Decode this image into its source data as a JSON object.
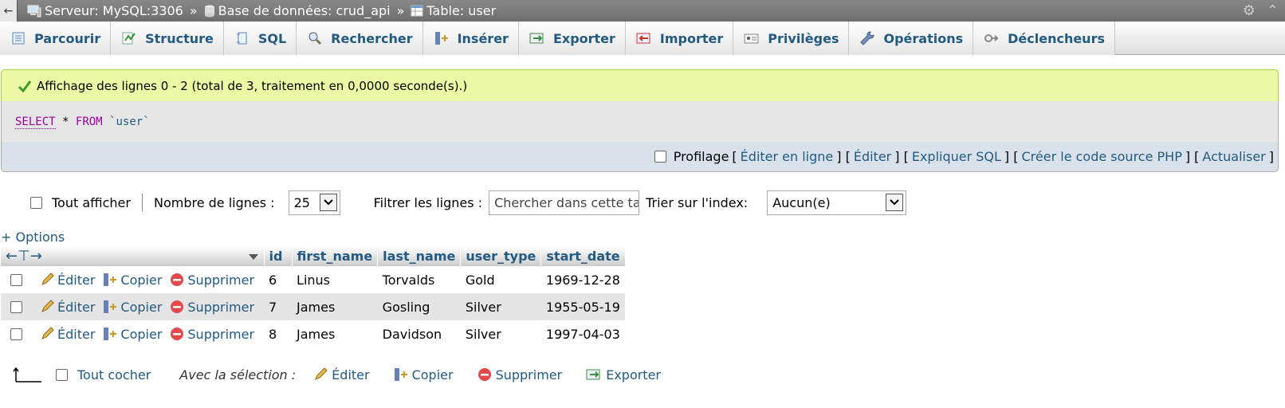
{
  "breadcrumb": {
    "server": "Serveur: MySQL:3306",
    "database": "Base de données: crud_api",
    "table": "Table: user",
    "separator": "»"
  },
  "tabs": [
    {
      "label": "Parcourir",
      "icon": "browse-icon"
    },
    {
      "label": "Structure",
      "icon": "structure-icon"
    },
    {
      "label": "SQL",
      "icon": "sql-icon"
    },
    {
      "label": "Rechercher",
      "icon": "search-icon"
    },
    {
      "label": "Insérer",
      "icon": "insert-icon"
    },
    {
      "label": "Exporter",
      "icon": "export-icon"
    },
    {
      "label": "Importer",
      "icon": "import-icon"
    },
    {
      "label": "Privilèges",
      "icon": "privileges-icon"
    },
    {
      "label": "Opérations",
      "icon": "wrench-icon"
    },
    {
      "label": "Déclencheurs",
      "icon": "triggers-icon"
    }
  ],
  "message": "Affichage des lignes 0 - 2 (total de 3, traitement en 0,0000 seconde(s).)",
  "sql": {
    "select": "SELECT",
    "star": "*",
    "from": "FROM",
    "table": "`user`"
  },
  "sql_actions": {
    "profiling": "Profilage",
    "edit_inline": "Éditer en ligne",
    "edit": "Éditer",
    "explain": "Expliquer SQL",
    "php": "Créer le code source PHP",
    "refresh": "Actualiser"
  },
  "filters": {
    "show_all": "Tout afficher",
    "rows_label": "Nombre de lignes :",
    "rows_value": "25",
    "filter_label": "Filtrer les lignes :",
    "filter_placeholder": "Chercher dans cette table",
    "sort_label": "Trier sur l'index:",
    "sort_value": "Aucun(e)"
  },
  "options_link": "+ Options",
  "table": {
    "columns": [
      "id",
      "first_name",
      "last_name",
      "user_type",
      "start_date"
    ],
    "row_actions": {
      "edit": "Éditer",
      "copy": "Copier",
      "delete": "Supprimer"
    },
    "rows": [
      [
        "6",
        "Linus",
        "Torvalds",
        "Gold",
        "1969-12-28"
      ],
      [
        "7",
        "James",
        "Gosling",
        "Silver",
        "1955-05-19"
      ],
      [
        "8",
        "James",
        "Davidson",
        "Silver",
        "1997-04-03"
      ]
    ]
  },
  "bulk": {
    "check_all": "Tout cocher",
    "with_selection": "Avec la sélection :",
    "edit": "Éditer",
    "copy": "Copier",
    "delete": "Supprimer",
    "export": "Exporter"
  },
  "colors": {
    "link": "#235a81",
    "success_bg": "#ebf8a4",
    "topbar": "#7a7a7a"
  }
}
